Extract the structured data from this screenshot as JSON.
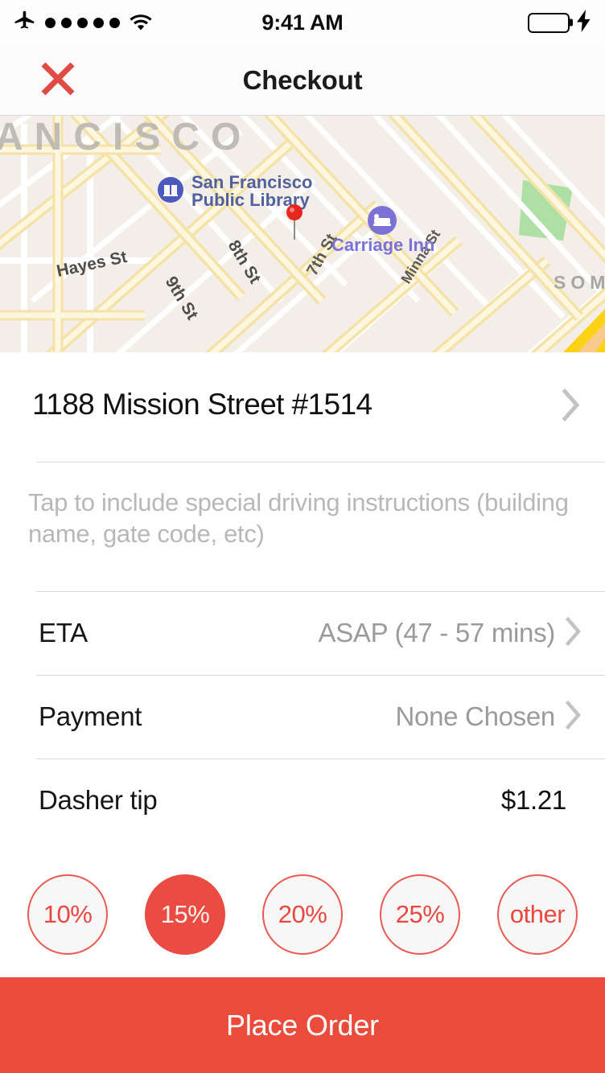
{
  "status_bar": {
    "airplane_icon": "airplane-mode-icon",
    "signal_dots": 5,
    "wifi_icon": "wifi-icon",
    "time": "9:41 AM",
    "battery_icon": "battery-full-icon",
    "battery_color": "#4cd964",
    "charging_icon": "charging-bolt-icon"
  },
  "nav": {
    "close_icon": "close-x-icon",
    "close_color": "#e04b43",
    "title": "Checkout"
  },
  "map": {
    "region_label_primary": "ANCISCO",
    "region_label_secondary": "SOMA",
    "pin_icon": "map-pin-icon",
    "pin_color": "#e8261f",
    "places": [
      {
        "name": "San Francisco Public Library",
        "icon": "library-book-icon",
        "color": "#4a5bbd"
      },
      {
        "name": "Carriage Inn",
        "icon": "hotel-bed-icon",
        "color": "#7b72d8"
      }
    ],
    "streets": [
      "7th St",
      "Minna St",
      "8th St",
      "9th St",
      "Hayes St"
    ],
    "colors": {
      "land": "#f3efe8",
      "road": "#ffffff",
      "arterial": "#fbe9b4",
      "highway": "#fcd217",
      "park": "#aee0a5"
    }
  },
  "delivery": {
    "address": "1188 Mission Street #1514",
    "instructions_placeholder": "Tap to include special driving instructions (building name, gate code, etc)",
    "instructions_value": "",
    "chevron_icon": "chevron-right-icon"
  },
  "rows": [
    {
      "label": "ETA",
      "value": "ASAP (47 - 57 mins)",
      "has_chevron": true,
      "value_muted": true
    },
    {
      "label": "Payment",
      "value": "None Chosen",
      "has_chevron": true,
      "value_muted": true
    },
    {
      "label": "Dasher tip",
      "value": "$1.21",
      "has_chevron": false,
      "value_muted": false
    }
  ],
  "tips": {
    "options": [
      {
        "label": "10%",
        "selected": false
      },
      {
        "label": "15%",
        "selected": true
      },
      {
        "label": "20%",
        "selected": false
      },
      {
        "label": "25%",
        "selected": false
      },
      {
        "label": "other",
        "selected": false
      }
    ],
    "accent_color": "#ea4b42"
  },
  "cta": {
    "label": "Place Order",
    "color": "#ea4b3a"
  }
}
